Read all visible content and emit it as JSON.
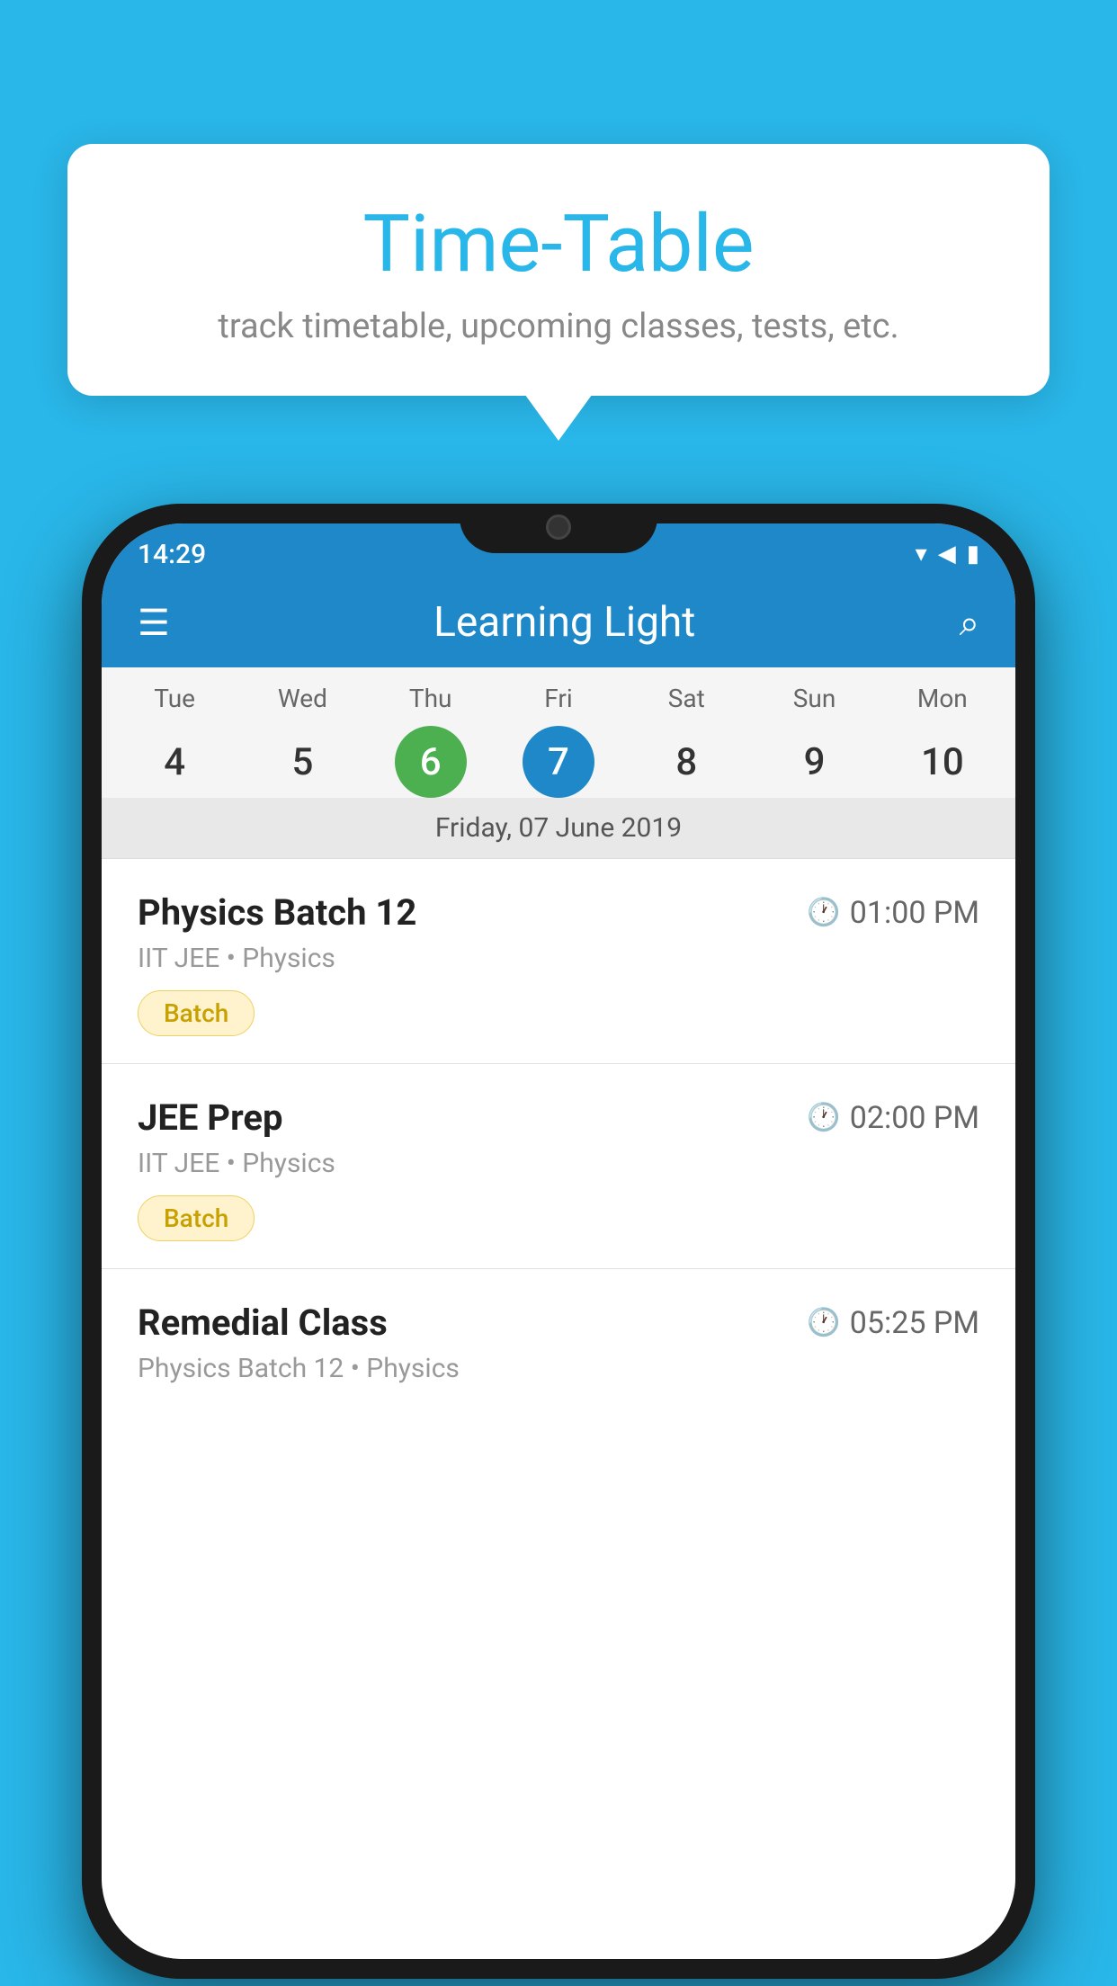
{
  "background": {
    "color": "#29b6e8"
  },
  "bubble": {
    "title": "Time-Table",
    "subtitle": "track timetable, upcoming classes, tests, etc."
  },
  "phone": {
    "statusBar": {
      "time": "14:29"
    },
    "appBar": {
      "title": "Learning Light"
    },
    "calendar": {
      "days": [
        {
          "name": "Tue",
          "num": "4",
          "state": "normal"
        },
        {
          "name": "Wed",
          "num": "5",
          "state": "normal"
        },
        {
          "name": "Thu",
          "num": "6",
          "state": "today"
        },
        {
          "name": "Fri",
          "num": "7",
          "state": "selected"
        },
        {
          "name": "Sat",
          "num": "8",
          "state": "normal"
        },
        {
          "name": "Sun",
          "num": "9",
          "state": "normal"
        },
        {
          "name": "Mon",
          "num": "10",
          "state": "normal"
        }
      ],
      "selectedDate": "Friday, 07 June 2019"
    },
    "schedule": [
      {
        "title": "Physics Batch 12",
        "time": "01:00 PM",
        "subtitle": "IIT JEE • Physics",
        "badge": "Batch"
      },
      {
        "title": "JEE Prep",
        "time": "02:00 PM",
        "subtitle": "IIT JEE • Physics",
        "badge": "Batch"
      },
      {
        "title": "Remedial Class",
        "time": "05:25 PM",
        "subtitle": "Physics Batch 12 • Physics",
        "badge": null
      }
    ]
  }
}
